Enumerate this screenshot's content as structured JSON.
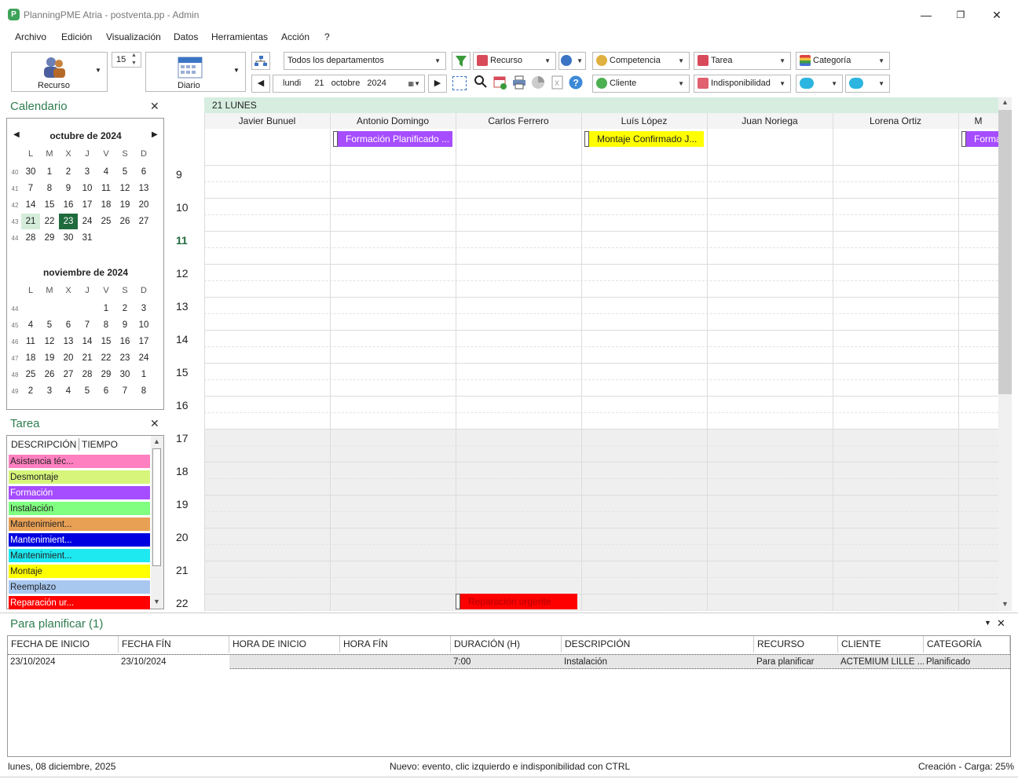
{
  "window": {
    "title": "PlanningPME Atria - postventa.pp - Admin",
    "app_icon": "P",
    "minimize": "—",
    "maximize": "❐",
    "close": "✕"
  },
  "menu": [
    "Archivo",
    "Edición",
    "Visualización",
    "Datos",
    "Herramientas",
    "Acción",
    "?"
  ],
  "toolbar": {
    "resource_view_label": "Recurso",
    "days_count": "15",
    "view_mode_label": "Diario",
    "department": "Todos los departamentos",
    "date_day": "lundi",
    "date_num": "21",
    "date_month": "octobre",
    "date_year": "2024",
    "filter_resource": "Recurso",
    "filter_competencia": "Competencia",
    "filter_cliente": "Cliente",
    "filter_tarea": "Tarea",
    "filter_indisponibilidad": "Indisponibilidad",
    "filter_categoria": "Categoría"
  },
  "calendar": {
    "title": "Calendario",
    "weekdays": [
      "L",
      "M",
      "X",
      "J",
      "V",
      "S",
      "D"
    ],
    "months": [
      {
        "name": "octubre de 2024",
        "weeks": [
          {
            "wk": "40",
            "days": [
              "30",
              "1",
              "2",
              "3",
              "4",
              "5",
              "6"
            ]
          },
          {
            "wk": "41",
            "days": [
              "7",
              "8",
              "9",
              "10",
              "11",
              "12",
              "13"
            ]
          },
          {
            "wk": "42",
            "days": [
              "14",
              "15",
              "16",
              "17",
              "18",
              "19",
              "20"
            ]
          },
          {
            "wk": "43",
            "days": [
              "21",
              "22",
              "23",
              "24",
              "25",
              "26",
              "27"
            ]
          },
          {
            "wk": "44",
            "days": [
              "28",
              "29",
              "30",
              "31",
              "",
              "",
              ""
            ]
          }
        ]
      },
      {
        "name": "noviembre de 2024",
        "weeks": [
          {
            "wk": "44",
            "days": [
              "",
              "",
              "",
              "",
              "1",
              "2",
              "3"
            ]
          },
          {
            "wk": "45",
            "days": [
              "4",
              "5",
              "6",
              "7",
              "8",
              "9",
              "10"
            ]
          },
          {
            "wk": "46",
            "days": [
              "11",
              "12",
              "13",
              "14",
              "15",
              "16",
              "17"
            ]
          },
          {
            "wk": "47",
            "days": [
              "18",
              "19",
              "20",
              "21",
              "22",
              "23",
              "24"
            ]
          },
          {
            "wk": "48",
            "days": [
              "25",
              "26",
              "27",
              "28",
              "29",
              "30",
              "1"
            ]
          },
          {
            "wk": "49",
            "days": [
              "2",
              "3",
              "4",
              "5",
              "6",
              "7",
              "8"
            ]
          }
        ]
      }
    ],
    "selected_day": "21",
    "today_day": "23"
  },
  "tasks_panel": {
    "title": "Tarea",
    "col_desc": "DESCRIPCIÓN",
    "col_time": "TIEMPO",
    "items": [
      {
        "label": "Asistencia téc...",
        "color": "#ff80c0",
        "text": "#222"
      },
      {
        "label": "Desmontaje",
        "color": "#d6f57a",
        "text": "#222"
      },
      {
        "label": "Formación",
        "color": "#a64dff",
        "text": "#fff"
      },
      {
        "label": "Instalación",
        "color": "#80ff80",
        "text": "#222"
      },
      {
        "label": "Mantenimient...",
        "color": "#e8a055",
        "text": "#222"
      },
      {
        "label": "Mantenimient...",
        "color": "#0000e0",
        "text": "#fff"
      },
      {
        "label": "Mantenimient...",
        "color": "#1ee8f0",
        "text": "#222"
      },
      {
        "label": "Montaje",
        "color": "#ffff00",
        "text": "#222"
      },
      {
        "label": "Reemplazo",
        "color": "#a8c8f0",
        "text": "#222"
      },
      {
        "label": "Reparación ur...",
        "color": "#ff0000",
        "text": "#fff"
      }
    ]
  },
  "schedule": {
    "day_header": "21 LUNES",
    "resources": [
      "Javier Bunuel",
      "Antonio Domingo",
      "Carlos Ferrero",
      "Luís López",
      "Juan Noriega",
      "Lorena Ortiz",
      "M"
    ],
    "hours": [
      "9",
      "10",
      "11",
      "12",
      "13",
      "14",
      "15",
      "16",
      "17",
      "18",
      "19",
      "20",
      "21",
      "22"
    ],
    "current_hour": "11",
    "events": [
      {
        "label": "Formación Planificado ...",
        "color": "#a64dff",
        "text": "#fff"
      },
      {
        "label": "Montaje Confirmado J...",
        "color": "#ffff00",
        "text": "#222"
      },
      {
        "label": "Forma",
        "color": "#a64dff",
        "text": "#fff"
      },
      {
        "label": "Reparación urgente",
        "color": "#ff0000",
        "text": "#b00000"
      }
    ]
  },
  "to_plan": {
    "title": "Para planificar (1)",
    "columns": [
      "FECHA DE INICIO",
      "FECHA FÍN",
      "HORA DE INICIO",
      "HORA FÍN",
      "DURACIÓN (H)",
      "DESCRIPCIÓN",
      "RECURSO",
      "CLIENTE",
      "CATEGORÍA"
    ],
    "rows": [
      [
        "23/10/2024",
        "23/10/2024",
        "",
        "",
        "7:00",
        "Instalación",
        "Para planificar",
        "ACTEMIUM LILLE ...",
        "Planificado"
      ]
    ]
  },
  "status_bar": {
    "date": "lunes, 08 diciembre, 2025",
    "hint": "Nuevo: evento, clic izquierdo e indisponibilidad con CTRL",
    "load": "Creación - Carga: 25%"
  },
  "colors": {
    "accent": "#2e7d4f",
    "today": "#1f6b3d",
    "day_band": "#d6ede0"
  }
}
